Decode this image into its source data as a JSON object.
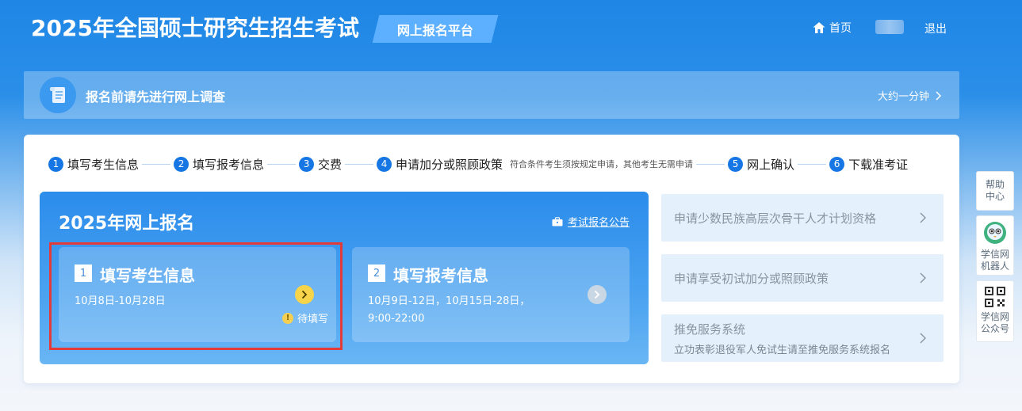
{
  "header": {
    "title": "2025年全国硕士研究生招生考试",
    "platform_tag": "网上报名平台",
    "home_label": "首页",
    "logout_label": "退出"
  },
  "survey": {
    "text": "报名前请先进行网上调查",
    "time": "大约一分钟"
  },
  "steps": [
    {
      "num": "1",
      "label": "填写考生信息"
    },
    {
      "num": "2",
      "label": "填写报考信息"
    },
    {
      "num": "3",
      "label": "交费"
    },
    {
      "num": "4",
      "label": "申请加分或照顾政策",
      "note": "符合条件考生须按规定申请，其他考生无需申请"
    },
    {
      "num": "5",
      "label": "网上确认"
    },
    {
      "num": "6",
      "label": "下载准考证"
    }
  ],
  "panel": {
    "title": "2025年网上报名",
    "notice_link": "考试报名公告",
    "cards": [
      {
        "num": "1",
        "title": "填写考生信息",
        "date_line1": "10月8日-10月28日",
        "status": "待填写"
      },
      {
        "num": "2",
        "title": "填写报考信息",
        "date_line1": "10月9日-12日，10月15日-28日，",
        "date_line2": "9:00-22:00"
      }
    ]
  },
  "side_items": [
    {
      "label": "申请少数民族高层次骨干人才计划资格"
    },
    {
      "label": "申请享受初试加分或照顾政策"
    },
    {
      "label": "推免服务系统",
      "sublabel": "立功表彰退役军人免试生请至推免服务系统报名"
    }
  ],
  "float_bar": {
    "help_line1": "帮助",
    "help_line2": "中心",
    "robot_line1": "学信网",
    "robot_line2": "机器人",
    "wechat_line1": "学信网",
    "wechat_line2": "公众号"
  },
  "colors": {
    "primary": "#1677e4",
    "highlight": "#e33a3a",
    "status_yellow": "#f7d449"
  }
}
